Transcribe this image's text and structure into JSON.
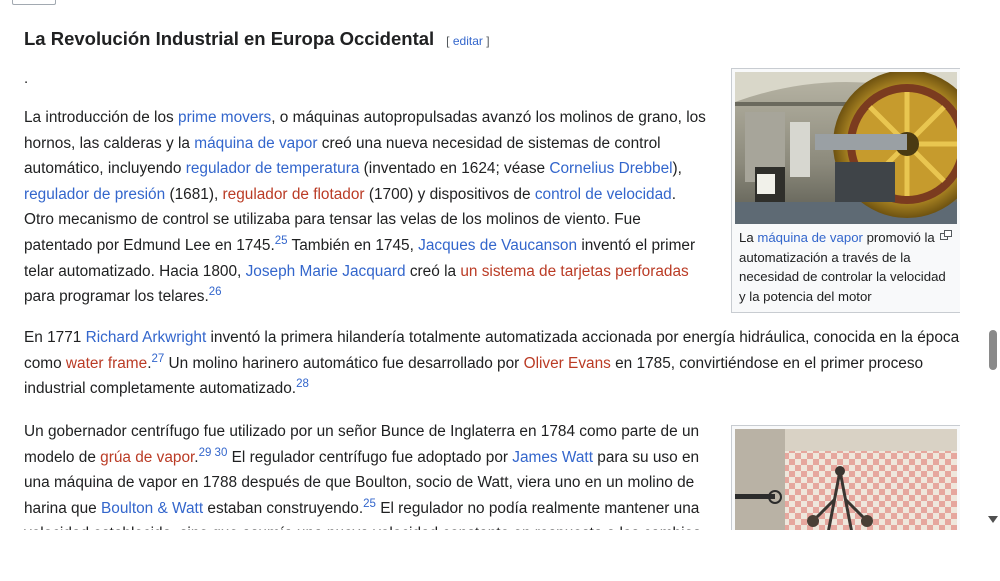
{
  "section": {
    "title": "La Revolución Industrial en Europa Occidental",
    "edit_open": "[ ",
    "edit_label": "editar",
    "edit_close": " ]",
    "dot": "."
  },
  "p1": {
    "t1": "La introducción de los ",
    "l_prime": "prime movers",
    "t2": ", o máquinas autopropulsadas avanzó los molinos de grano, los hornos, las calderas y la ",
    "l_maquina": "máquina de vapor",
    "t3": " creó una nueva necesidad de sistemas de control automático, incluyendo ",
    "l_temp": "regulador de temperatura",
    "t4": " (inventado en 1624; véase ",
    "l_drebbel": "Cornelius Drebbel",
    "t5": "), ",
    "l_presion": "regulador de presión",
    "t6": " (1681), ",
    "l_flotador": "regulador de flotador",
    "t7": " (1700) y dispositivos de ",
    "l_velocidad": "control de velocidad",
    "t8": ". Otro mecanismo de control se utilizaba para tensar las velas de los molinos de viento. Fue patentado por Edmund Lee en 1745.",
    "ref25": "25",
    "t9": "  También en 1745, ",
    "l_vaucanson": "Jacques de Vaucanson",
    "t10": " inventó el primer telar automatizado. Hacia 1800, ",
    "l_jacquard": "Joseph Marie Jacquard",
    "t11": " creó la ",
    "l_tarjetas": "un sistema de tarjetas perforadas",
    "t12": " para programar los telares.",
    "ref26": "26"
  },
  "p2": {
    "t1": "En 1771 ",
    "l_arkwright": "Richard Arkwright",
    "t2": " inventó la primera hilandería totalmente automatizada accionada por energía hidráulica, conocida en la época como ",
    "l_waterframe": "water frame",
    "t3": ".",
    "ref27": "27",
    "t4": "  Un molino harinero automático fue desarrollado por ",
    "l_evans": "Oliver Evans",
    "t5": " en 1785, convirtiéndose en el primer proceso industrial completamente automatizado.",
    "ref28": "28"
  },
  "p3": {
    "t1": "Un gobernador centrífugo fue utilizado por un señor Bunce de Inglaterra en 1784 como parte de un modelo de ",
    "l_grua": "grúa de vapor",
    "t2": ".",
    "ref29": "29",
    "ref30": " 30",
    "t3": "  El regulador centrífugo fue adoptado por ",
    "l_watt": "James Watt",
    "t4": " para su uso en una máquina de vapor en 1788 después de que Boulton, socio de Watt, viera uno en un molino de harina que ",
    "l_boulton": "Boulton & Watt",
    "t5": " estaban construyendo.",
    "ref25b": "25",
    "t6": "  El regulador no podía realmente mantener una velocidad establecida, sino que asumía una nueva velocidad constante en respuesta a los cambios de carga."
  },
  "figure1": {
    "caption_t1": "La ",
    "caption_link": "máquina de vapor",
    "caption_t2": " promovió la automatización a través de la necesidad de controlar la velocidad y la potencia del motor"
  },
  "colors": {
    "link": "#3366cc",
    "redlink": "#ba3b25",
    "text": "#202122"
  }
}
